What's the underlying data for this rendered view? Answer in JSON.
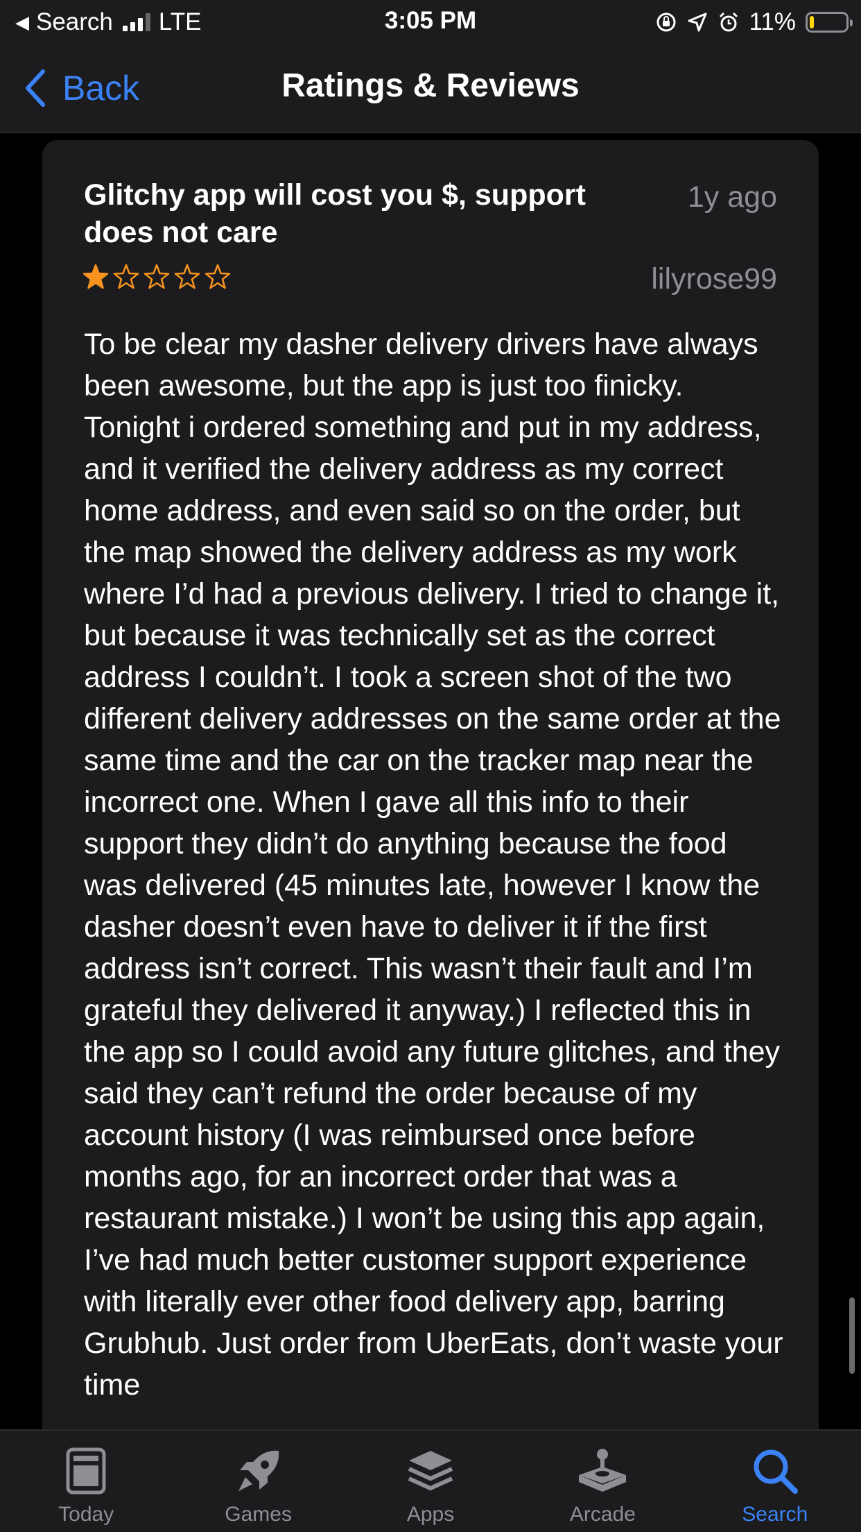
{
  "status_bar": {
    "carrier_back": "Search",
    "network": "LTE",
    "time": "3:05 PM",
    "battery": "11%",
    "battery_level": 0.11
  },
  "nav": {
    "back_label": "Back",
    "title": "Ratings & Reviews"
  },
  "review": {
    "title": "Glitchy app will cost you $, support does not care",
    "date": "1y ago",
    "rating": 1,
    "max_rating": 5,
    "author": "lilyrose99",
    "body": "To be clear my dasher delivery drivers have always been awesome, but the app is just too finicky. Tonight i ordered something and put in my address, and it verified the delivery address as my correct home address, and even said so on the order, but the map showed the delivery address as my work where I’d had a previous delivery. I tried to change it, but because it was technically set as the correct address I couldn’t. I took a screen shot of the two different delivery addresses on the same order at the same time and the car on the tracker map near the incorrect one. When I gave all this info to their support they didn’t do anything because the food was delivered (45 minutes late, however I know the dasher doesn’t even have to deliver it if the first address isn’t correct. This wasn’t their fault and I’m grateful they delivered it anyway.) I reflected this in the app so I could avoid any future glitches, and they said they can’t refund the order because of my account history (I was reimbursed once before months ago, for an incorrect order that was a restaurant mistake.) I won’t be using this app again, I’ve had much better customer support experience with literally ever other food delivery app, barring Grubhub. Just order from UberEats, don’t waste your time"
  },
  "tabs": [
    {
      "label": "Today",
      "icon": "today-icon",
      "active": false
    },
    {
      "label": "Games",
      "icon": "rocket-icon",
      "active": false
    },
    {
      "label": "Apps",
      "icon": "layers-icon",
      "active": false
    },
    {
      "label": "Arcade",
      "icon": "joystick-icon",
      "active": false
    },
    {
      "label": "Search",
      "icon": "search-icon",
      "active": true
    }
  ],
  "colors": {
    "accent": "#3b82f6",
    "star": "#f7931e",
    "secondary_text": "#8e8e93",
    "card_bg": "#1c1c1e"
  }
}
